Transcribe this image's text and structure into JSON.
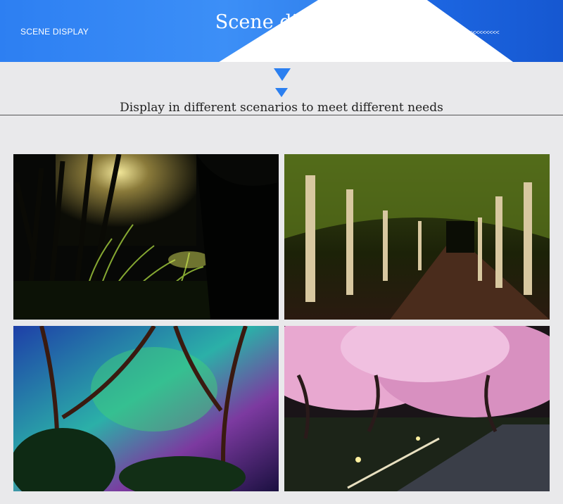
{
  "header": {
    "left_label": "SCENE DISPLAY",
    "title": "Scene display",
    "arrows": "<<<<<<<<<<<<<<<<<<<<"
  },
  "subtitle": "Display in different scenarios to meet different needs",
  "colors": {
    "accent": "#2b7ff0",
    "banner": "#2d7ff2"
  },
  "photos": [
    {
      "name": "garden-spotlight-photo"
    },
    {
      "name": "tree-lined-path-photo"
    },
    {
      "name": "colorful-trees-photo"
    },
    {
      "name": "cherry-blossom-path-photo"
    }
  ]
}
